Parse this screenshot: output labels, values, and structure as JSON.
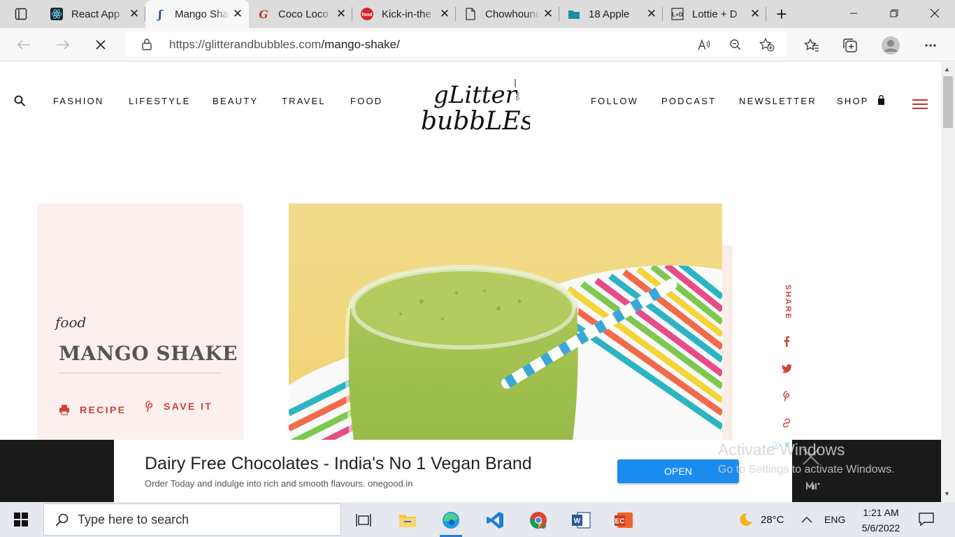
{
  "browser": {
    "tabs": [
      {
        "title": "React App",
        "icon": "react-icon",
        "active": false
      },
      {
        "title": "Mango Shake",
        "icon": "glitter-bubbles-icon",
        "active": true
      },
      {
        "title": "Coco Loco",
        "icon": "coco-loco-icon",
        "active": false
      },
      {
        "title": "Kick-in-the",
        "icon": "food-network-icon",
        "active": false
      },
      {
        "title": "Chowhound",
        "icon": "document-icon",
        "active": false
      },
      {
        "title": "18 Apple",
        "icon": "folder-icon",
        "active": false
      },
      {
        "title": "Lottie + D",
        "icon": "lottie-icon",
        "active": false
      }
    ],
    "url_base": "https://glitterandbubbles.com",
    "url_path": "/mango-shake/"
  },
  "site": {
    "nav_left": [
      "FASHION",
      "LIFESTYLE",
      "BEAUTY",
      "TRAVEL",
      "FOOD"
    ],
    "nav_right": [
      "FOLLOW",
      "PODCAST",
      "NEWSLETTER",
      "SHOP"
    ],
    "logo_top": "gLitter",
    "logo_and": "AND",
    "logo_bottom": "bubbLEs",
    "accent_color": "#d0423a"
  },
  "post": {
    "category": "food",
    "title": "MANGO SHAKE",
    "recipe_label": "RECIPE",
    "save_label": "SAVE IT",
    "share_label": "SHARE",
    "share_icons": [
      "facebook-icon",
      "twitter-icon",
      "pinterest-icon",
      "link-icon"
    ]
  },
  "ad": {
    "headline": "Dairy Free Chocolates - India's No 1 Vegan Brand",
    "subtext": "Order Today and indulge into rich and smooth flavours. onegood.in",
    "button": "OPEN"
  },
  "watermark": {
    "line1": "Activate Windows",
    "line2": "Go to Settings to activate Windows."
  },
  "taskbar": {
    "search_placeholder": "Type here to search",
    "temperature": "28°C",
    "language": "ENG",
    "time": "1:21 AM",
    "date": "5/6/2022"
  }
}
